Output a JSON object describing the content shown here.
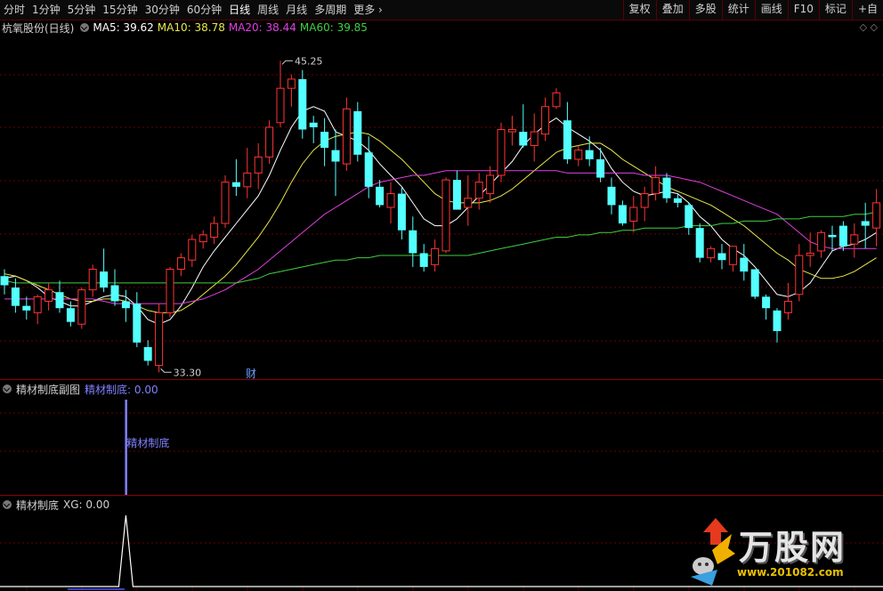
{
  "toolbar": {
    "left_items": [
      "分时",
      "1分钟",
      "5分钟",
      "15分钟",
      "30分钟",
      "60分钟",
      "日线",
      "周线",
      "月线",
      "多周期",
      "更多"
    ],
    "more_chevron": "chevron-right-icon",
    "right_buttons": [
      "复权",
      "叠加",
      "多股",
      "统计",
      "画线",
      "F10",
      "标记",
      "+自"
    ]
  },
  "main_panel": {
    "stock_label": "杭氧股份(日线)",
    "ma_labels": [
      {
        "text": "MA5: 39.62",
        "color": "#ffffff"
      },
      {
        "text": "MA10: 38.78",
        "color": "#e8e84a"
      },
      {
        "text": "MA20: 38.44",
        "color": "#e040e0"
      },
      {
        "text": "MA60: 39.85",
        "color": "#40d040"
      }
    ],
    "high_label": "45.25",
    "low_label": "33.30",
    "cai_marker": "财",
    "diamonds": "◇ ◇"
  },
  "sub1": {
    "title": "精材制底副图",
    "value_label": "精材制底: 0.00",
    "signal_text": "精材制底",
    "color": "#8080ff"
  },
  "sub2": {
    "title": "精材制底",
    "value_label": "XG: 0.00"
  },
  "logo": {
    "brand": "万股网",
    "url": "www.201082.com"
  },
  "colors": {
    "up": "#ff3333",
    "down": "#54ffff",
    "grid": "#6a0000",
    "ma5": "#ffffff",
    "ma10": "#e8e84a",
    "ma20": "#e040e0",
    "ma60": "#40d040"
  },
  "chart_data": {
    "type": "candlestick",
    "ylim": [
      32.6,
      47.6
    ],
    "candles": [
      [
        37.1,
        37.4,
        36.3,
        36.7
      ],
      [
        36.6,
        37.0,
        35.5,
        35.8
      ],
      [
        35.8,
        36.2,
        35.2,
        35.6
      ],
      [
        35.5,
        36.3,
        35.0,
        36.2
      ],
      [
        36.0,
        36.8,
        35.6,
        36.5
      ],
      [
        36.4,
        36.9,
        35.5,
        35.7
      ],
      [
        35.7,
        36.0,
        34.9,
        35.1
      ],
      [
        35.0,
        36.6,
        34.8,
        36.5
      ],
      [
        36.5,
        37.6,
        36.2,
        37.4
      ],
      [
        37.3,
        38.3,
        36.4,
        36.6
      ],
      [
        36.7,
        37.4,
        35.8,
        36.0
      ],
      [
        36.0,
        36.5,
        35.1,
        35.7
      ],
      [
        35.9,
        36.4,
        34.0,
        34.2
      ],
      [
        34.0,
        34.3,
        33.2,
        33.4
      ],
      [
        33.2,
        35.9,
        32.9,
        35.5
      ],
      [
        35.5,
        37.5,
        35.3,
        37.4
      ],
      [
        37.4,
        38.1,
        37.1,
        37.9
      ],
      [
        37.8,
        38.9,
        37.5,
        38.7
      ],
      [
        38.6,
        39.1,
        38.3,
        38.9
      ],
      [
        38.8,
        39.7,
        38.5,
        39.4
      ],
      [
        39.4,
        41.5,
        39.2,
        41.2
      ],
      [
        41.2,
        42.2,
        40.6,
        41.0
      ],
      [
        41.0,
        42.7,
        40.5,
        41.6
      ],
      [
        41.6,
        42.9,
        40.9,
        42.3
      ],
      [
        42.3,
        43.9,
        42.0,
        43.6
      ],
      [
        43.8,
        46.5,
        43.6,
        45.3
      ],
      [
        45.3,
        45.9,
        44.5,
        45.7
      ],
      [
        45.7,
        46.1,
        43.1,
        43.5
      ],
      [
        43.8,
        44.1,
        42.9,
        43.6
      ],
      [
        43.4,
        44.0,
        41.9,
        42.7
      ],
      [
        42.6,
        43.5,
        40.6,
        42.1
      ],
      [
        42.0,
        44.9,
        41.7,
        44.4
      ],
      [
        44.3,
        44.7,
        42.1,
        42.4
      ],
      [
        42.5,
        43.2,
        40.5,
        41.0
      ],
      [
        41.0,
        41.3,
        40.1,
        40.2
      ],
      [
        40.1,
        41.2,
        39.4,
        40.7
      ],
      [
        40.7,
        41.0,
        38.7,
        39.1
      ],
      [
        39.1,
        39.7,
        37.5,
        38.1
      ],
      [
        38.1,
        38.5,
        37.3,
        37.5
      ],
      [
        37.6,
        38.7,
        37.3,
        38.3
      ],
      [
        38.2,
        41.4,
        38.1,
        41.3
      ],
      [
        41.3,
        41.7,
        40.0,
        40.0
      ],
      [
        40.1,
        41.5,
        39.3,
        40.5
      ],
      [
        40.5,
        41.6,
        40.0,
        41.2
      ],
      [
        40.7,
        41.9,
        40.3,
        41.5
      ],
      [
        41.5,
        43.8,
        41.2,
        43.5
      ],
      [
        43.4,
        44.1,
        42.8,
        43.5
      ],
      [
        43.4,
        44.6,
        42.7,
        42.8
      ],
      [
        42.8,
        44.2,
        42.1,
        43.4
      ],
      [
        43.3,
        44.9,
        43.0,
        44.5
      ],
      [
        44.5,
        45.3,
        44.4,
        45.1
      ],
      [
        43.9,
        44.7,
        42.0,
        42.2
      ],
      [
        42.2,
        42.8,
        41.9,
        42.6
      ],
      [
        42.6,
        43.2,
        41.9,
        42.2
      ],
      [
        42.2,
        42.7,
        41.2,
        41.4
      ],
      [
        41.0,
        41.4,
        39.8,
        40.2
      ],
      [
        40.2,
        40.4,
        39.3,
        39.4
      ],
      [
        39.5,
        40.6,
        39.0,
        40.1
      ],
      [
        40.1,
        41.0,
        39.5,
        40.7
      ],
      [
        40.7,
        41.9,
        40.4,
        41.4
      ],
      [
        41.4,
        41.6,
        40.3,
        40.5
      ],
      [
        40.5,
        40.7,
        40.1,
        40.3
      ],
      [
        40.2,
        40.3,
        38.9,
        39.2
      ],
      [
        39.2,
        39.4,
        37.7,
        37.9
      ],
      [
        37.9,
        38.4,
        37.7,
        38.3
      ],
      [
        38.1,
        38.5,
        37.4,
        37.8
      ],
      [
        37.6,
        38.4,
        37.3,
        38.4
      ],
      [
        37.9,
        38.5,
        36.9,
        37.3
      ],
      [
        37.4,
        37.4,
        36.1,
        36.2
      ],
      [
        36.2,
        36.3,
        35.2,
        35.7
      ],
      [
        35.6,
        35.7,
        34.2,
        34.7
      ],
      [
        35.5,
        36.8,
        35.2,
        36.0
      ],
      [
        36.3,
        38.5,
        36.0,
        38.0
      ],
      [
        38.0,
        39.0,
        37.5,
        38.1
      ],
      [
        38.2,
        39.1,
        37.9,
        39.0
      ],
      [
        38.9,
        39.3,
        38.2,
        38.8
      ],
      [
        39.3,
        39.5,
        38.2,
        38.4
      ],
      [
        38.5,
        39.4,
        37.9,
        38.9
      ],
      [
        39.5,
        40.3,
        38.3,
        39.3
      ],
      [
        39.2,
        40.9,
        38.4,
        40.3
      ]
    ],
    "ma_series": [
      {
        "name": "MA5",
        "values": [
          37.0,
          37.1,
          36.9,
          36.6,
          36.2,
          36.0,
          35.8,
          35.8,
          36.0,
          36.2,
          36.3,
          36.2,
          35.8,
          35.2,
          35.0,
          35.2,
          35.8,
          36.6,
          37.5,
          38.2,
          38.8,
          39.4,
          40.0,
          40.6,
          41.5,
          42.6,
          43.6,
          44.3,
          44.5,
          44.3,
          43.4,
          43.2,
          43.0,
          42.6,
          42.0,
          41.5,
          41.0,
          40.3,
          39.6,
          39.3,
          39.3,
          39.6,
          40.1,
          40.6,
          41.1,
          41.6,
          42.1,
          42.8,
          43.3,
          43.7,
          44.0,
          43.6,
          43.3,
          43.0,
          42.6,
          41.8,
          41.2,
          40.8,
          40.6,
          40.7,
          40.8,
          40.7,
          40.3,
          39.7,
          39.3,
          38.7,
          38.3,
          38.0,
          37.5,
          36.9,
          36.3,
          36.2,
          36.4,
          36.8,
          37.5,
          38.2,
          38.4,
          38.5,
          38.7,
          39.0
        ]
      },
      {
        "name": "MA10",
        "values": [
          37.2,
          37.1,
          36.9,
          36.7,
          36.5,
          36.3,
          36.1,
          36.0,
          36.0,
          36.1,
          36.1,
          36.0,
          35.8,
          35.6,
          35.5,
          35.5,
          35.6,
          35.9,
          36.3,
          36.7,
          37.1,
          37.6,
          38.2,
          38.8,
          39.5,
          40.3,
          41.2,
          42.0,
          42.6,
          43.0,
          43.2,
          43.3,
          43.4,
          43.3,
          43.0,
          42.6,
          42.2,
          41.7,
          41.2,
          40.7,
          40.4,
          40.3,
          40.3,
          40.3,
          40.4,
          40.6,
          40.9,
          41.3,
          41.7,
          42.1,
          42.5,
          42.7,
          42.8,
          42.9,
          42.9,
          42.6,
          42.2,
          41.9,
          41.6,
          41.3,
          41.0,
          40.8,
          40.6,
          40.4,
          40.2,
          39.9,
          39.6,
          39.3,
          38.9,
          38.5,
          38.1,
          37.8,
          37.4,
          37.2,
          37.0,
          37.0,
          37.1,
          37.3,
          37.6,
          37.9
        ]
      },
      {
        "name": "MA20",
        "values": [
          36.1,
          36.1,
          36.1,
          36.1,
          36.1,
          36.1,
          36.1,
          36.1,
          36.1,
          36.0,
          35.9,
          35.9,
          35.9,
          35.9,
          35.9,
          35.9,
          35.9,
          36.0,
          36.1,
          36.3,
          36.5,
          36.8,
          37.1,
          37.4,
          37.8,
          38.2,
          38.6,
          39.0,
          39.4,
          39.8,
          40.1,
          40.4,
          40.7,
          41.0,
          41.2,
          41.3,
          41.4,
          41.5,
          41.5,
          41.6,
          41.7,
          41.7,
          41.7,
          41.7,
          41.7,
          41.7,
          41.7,
          41.7,
          41.7,
          41.7,
          41.7,
          41.6,
          41.6,
          41.6,
          41.6,
          41.6,
          41.6,
          41.6,
          41.5,
          41.5,
          41.5,
          41.4,
          41.3,
          41.2,
          41.0,
          40.8,
          40.6,
          40.4,
          40.2,
          40.0,
          39.8,
          39.4,
          39.0,
          38.6,
          38.4,
          38.3,
          38.3,
          38.3,
          38.3,
          38.3
        ]
      },
      {
        "name": "MA60",
        "values": [
          36.9,
          36.8,
          36.8,
          36.8,
          36.8,
          36.8,
          36.8,
          36.8,
          36.8,
          36.8,
          36.8,
          36.8,
          36.8,
          36.8,
          36.8,
          36.8,
          36.8,
          36.8,
          36.8,
          36.8,
          36.8,
          36.8,
          36.9,
          37.0,
          37.2,
          37.3,
          37.4,
          37.5,
          37.6,
          37.7,
          37.8,
          37.8,
          37.9,
          37.9,
          38.0,
          38.0,
          38.0,
          38.0,
          38.0,
          38.0,
          38.0,
          38.0,
          38.0,
          38.1,
          38.2,
          38.3,
          38.4,
          38.5,
          38.6,
          38.7,
          38.8,
          38.8,
          38.9,
          38.9,
          39.0,
          39.0,
          39.1,
          39.1,
          39.2,
          39.2,
          39.2,
          39.2,
          39.3,
          39.3,
          39.3,
          39.4,
          39.4,
          39.5,
          39.5,
          39.5,
          39.6,
          39.6,
          39.6,
          39.7,
          39.7,
          39.7,
          39.7,
          39.8,
          39.8,
          39.9
        ]
      }
    ],
    "sub1_signal": {
      "index": 11,
      "value": 1
    },
    "sub2_xg": {
      "index": 11,
      "value": 1
    }
  }
}
